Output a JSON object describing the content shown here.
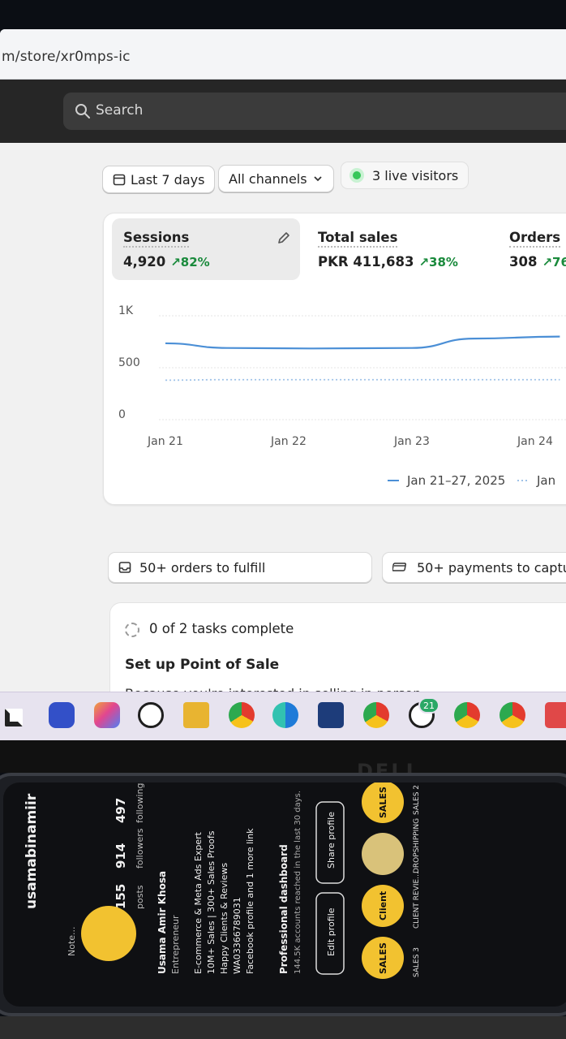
{
  "browser": {
    "url": "m/store/xr0mps-ic"
  },
  "admin": {
    "search_placeholder": "Search"
  },
  "filters": {
    "date_range": "Last 7 days",
    "channels": "All channels",
    "live_visitors": "3 live visitors"
  },
  "metrics": {
    "sessions": {
      "label": "Sessions",
      "value": "4,920",
      "change": "↗82%"
    },
    "total_sales": {
      "label": "Total sales",
      "value": "PKR 411,683",
      "change": "↗38%"
    },
    "orders": {
      "label": "Orders",
      "value": "308",
      "change": "↗76"
    }
  },
  "chart_data": {
    "type": "line",
    "ylabels": [
      "1K",
      "500",
      "0"
    ],
    "categories": [
      "Jan 21",
      "Jan 22",
      "Jan 23",
      "Jan 24"
    ],
    "ylim": [
      0,
      1000
    ],
    "series": [
      {
        "name": "Jan 21–27, 2025",
        "style": "solid",
        "color": "#4b8fd6",
        "values": [
          735,
          690,
          685,
          690,
          780,
          800
        ]
      },
      {
        "name": "Jan",
        "style": "dotted",
        "color": "#9fc2e8",
        "values": [
          380,
          385,
          385,
          385,
          385,
          385
        ]
      }
    ],
    "x_positions_days": [
      0,
      0.5,
      1.2,
      2,
      2.5,
      3.2
    ],
    "grid": true,
    "legend": "bottom-right"
  },
  "tasks": {
    "fulfill": "50+ orders to fulfill",
    "payments": "50+ payments to captu"
  },
  "setup": {
    "progress": "0 of 2 tasks complete",
    "title": "Set up Point of Sale",
    "description": "Because you're interested in selling in person"
  },
  "taskbar": {
    "apps": [
      "windows-icon",
      "meet-icon",
      "copilot-icon",
      "whatsapp-icon",
      "file-explorer-icon",
      "chrome-icon",
      "edge-icon",
      "store-icon",
      "chrome-icon",
      "whatsapp-icon",
      "chrome-icon",
      "chrome-icon",
      "download-icon"
    ],
    "whatsapp_badge": "21"
  },
  "monitor": {
    "brand": "DELL"
  },
  "phone": {
    "username": "usamabinamiir",
    "posts": "155",
    "posts_label": "posts",
    "followers": "914",
    "followers_label": "followers",
    "following": "497",
    "following_label": "following",
    "note": "Note...",
    "name": "Usama Amir Khosa",
    "category": "Entrepreneur",
    "bio": [
      "E-commerce & Meta Ads Expert",
      "10M+ Sales | 300+ Sales Proofs",
      "Happy Clients & Reviews",
      "WA03366789031",
      "Facebook profile and 1 more link"
    ],
    "dashboard_title": "Professional dashboard",
    "dashboard_sub": "144.5K accounts reached in the last 30 days.",
    "edit_profile": "Edit profile",
    "share_profile": "Share profile",
    "highlights": [
      "SALES 3",
      "CLIENT REVIE...",
      "DROPSHIPPING",
      "SALES 2"
    ],
    "highlight_badges": [
      "SALES",
      "Client",
      "SALES"
    ]
  }
}
